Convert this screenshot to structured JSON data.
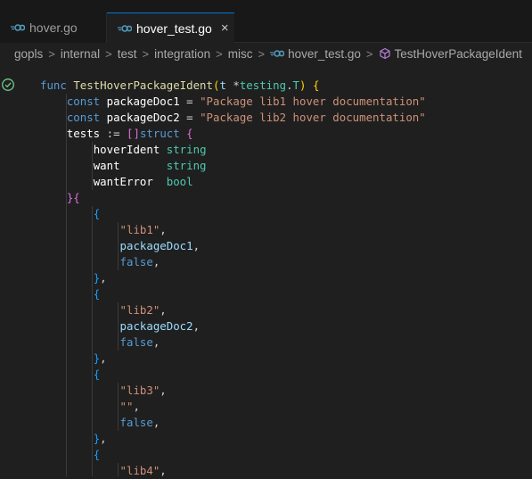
{
  "tabs": [
    {
      "label": "hover.go",
      "active": false
    },
    {
      "label": "hover_test.go",
      "active": true
    }
  ],
  "tab_close_symbol": "×",
  "breadcrumb": {
    "items": [
      "gopls",
      "internal",
      "test",
      "integration",
      "misc",
      "hover_test.go",
      "TestHoverPackageIdent"
    ],
    "separator": ">"
  },
  "colors": {
    "background": "#1f1f1f",
    "tabbar": "#181818",
    "accent": "#0078d4",
    "go_icon": "#519aba",
    "symbol_icon": "#b180d7",
    "test_pass": "#73c991"
  },
  "code": {
    "func_kw": "func",
    "func_name": "TestHoverPackageIdent",
    "param": "t",
    "param_type_ptr": "*",
    "param_pkg": "testing",
    "param_type": "T",
    "const_kw": "const",
    "const1_name": "packageDoc1",
    "const1_value": "\"Package lib1 hover documentation\"",
    "const2_name": "packageDoc2",
    "const2_value": "\"Package lib2 hover documentation\"",
    "tests_var": "tests",
    "assign_op": ":=",
    "struct_kw": "struct",
    "fields": [
      {
        "name": "hoverIdent",
        "type": "string"
      },
      {
        "name": "want",
        "type": "string"
      },
      {
        "name": "wantError",
        "type": "bool"
      }
    ],
    "cases": [
      {
        "ident": "\"lib1\"",
        "want": "packageDoc1",
        "want_is_str": false,
        "err": "false"
      },
      {
        "ident": "\"lib2\"",
        "want": "packageDoc2",
        "want_is_str": false,
        "err": "false"
      },
      {
        "ident": "\"lib3\"",
        "want": "\"\"",
        "want_is_str": true,
        "err": "false"
      }
    ],
    "last_case_ident": "\"lib4\""
  }
}
